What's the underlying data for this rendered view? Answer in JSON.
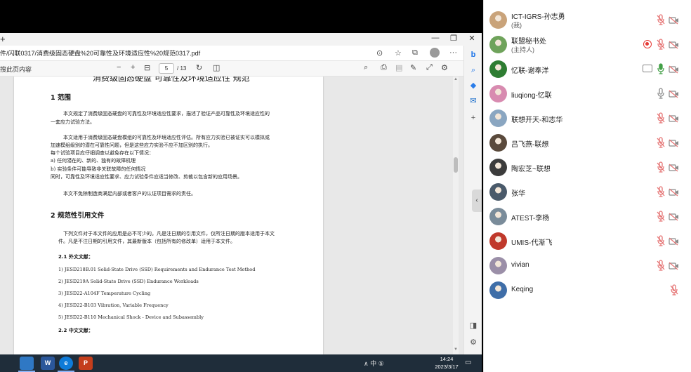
{
  "browser": {
    "new_tab_glyph": "+",
    "window_controls": {
      "minimize": "—",
      "restore": "❐",
      "close": "✕"
    },
    "url": "件/闪联0317/消费级固态硬盘%20可靠性及环境适应性%20规范0317.pdf",
    "pdf_toolbar": {
      "search_label": "搜此页内容",
      "zoom_out": "−",
      "zoom_in": "+",
      "current_page": "5",
      "total_pages": "/ 13"
    }
  },
  "document": {
    "title": "消费级固态硬盘 可靠性及环境适应性 规范",
    "section1_heading": "1  范围",
    "s1_p1_l1": "本文规定了消费级固态硬盘的可靠性及环境适应性要求，描述了验证产品可靠性及环境适应性的",
    "s1_p1_l2": "一套应力试验方法。",
    "s1_p2_l1": "本文适用于消费级固态硬盘模组的可靠性及环境适应性评估。所有应力实验已被证实可以模拟或",
    "s1_p2_l2": "加速模组级别的潜在可靠性问题，但是这些应力实验不应不加区别的执行。",
    "s1_p2_l3": "每个试验项目应仔细调查以避免存在以下情况：",
    "s1_item_a": "a)  任何潜在的、新的、独有的故障机理",
    "s1_item_b": "b)  实验条件可能导致非关联故障的任何情况",
    "s1_p2_l4": "同时，可靠性及环境适应性要求、应力试验条件应适当修改、剪裁以包含新的应用场景。",
    "s1_p3": "本文不免除制造商满足内部或者客户的认证项目需求的责任。",
    "section2_heading": "2  规范性引用文件",
    "s2_p1_l1": "下列文件对于本文件的应用是必不可少的。凡是注日期的引用文件，仅所注日期的版本适用于本文",
    "s2_p1_l2": "件。凡是不注日期的引用文件，其最新版本（包括所有的修改单）适用于本文件。",
    "s2_1_heading": "2.1  外文文献：",
    "refs": [
      "1)  JESD218B.01 Solid-State Drive (SSD) Requirements and Endurance Test Method",
      "2)  JESD219A Solid-State Drive (SSD) Endurance Workloads",
      "3)  JESD22-A104F Temperature Cycling",
      "4)  JESD22-B103 Vibration, Variable Frequency",
      "5)  JESD22-B110 Mechanical Shock  -  Device and Subassembly"
    ],
    "s2_2_heading": "2.2  中文文献："
  },
  "taskbar": {
    "apps": [
      "W",
      "e",
      "P"
    ],
    "tray_text": "∧  中  ⑤",
    "time": "14:24",
    "date": "2023/3/17"
  },
  "participants": [
    {
      "name": "ICT-IGRS-孙志勇",
      "role": "(我)",
      "mic": "muted",
      "cam": "off",
      "avatar_color": "#c9a37a"
    },
    {
      "name": "联盟秘书处",
      "role": "(主持人)",
      "mic": "muted",
      "cam": "off",
      "recording": true,
      "avatar_color": "#6fa35b"
    },
    {
      "name": "忆联-谢奉洋",
      "role": "",
      "mic": "active",
      "cam": "off",
      "sharing": true,
      "avatar_color": "#2e7d32"
    },
    {
      "name": "liuqiong-忆联",
      "role": "",
      "mic": "on",
      "cam": "off",
      "avatar_color": "#d88bb0"
    },
    {
      "name": "联想开天-和志华",
      "role": "",
      "mic": "muted",
      "cam": "off",
      "avatar_color": "#8aa6c1"
    },
    {
      "name": "吕飞燕-联想",
      "role": "",
      "mic": "muted",
      "cam": "off",
      "avatar_color": "#5a4a3c"
    },
    {
      "name": "陶宏芝~联想",
      "role": "",
      "mic": "muted",
      "cam": "off",
      "avatar_color": "#3c3c3c"
    },
    {
      "name": "张华",
      "role": "",
      "mic": "muted",
      "cam": "off",
      "avatar_color": "#4a5a6a"
    },
    {
      "name": "ATEST-李杨",
      "role": "",
      "mic": "muted",
      "cam": "off",
      "avatar_color": "#7a8c9a"
    },
    {
      "name": "UMIS-代渐飞",
      "role": "",
      "mic": "muted",
      "cam": "off",
      "avatar_color": "#c0392b"
    },
    {
      "name": "vivian",
      "role": "",
      "mic": "muted",
      "cam": "off",
      "avatar_color": "#9b8fa8"
    },
    {
      "name": "Keqing",
      "role": "",
      "mic": "muted",
      "cam": "none",
      "avatar_color": "#3f6ea8"
    }
  ],
  "colors": {
    "muted_red": "#e57373",
    "active_green": "#43a047",
    "icon_gray": "#8a8a8a",
    "taskbar": "#1f2d3a"
  },
  "icons": [
    "mic-muted-icon",
    "camera-off-icon",
    "record-icon",
    "screen-share-icon",
    "search-icon",
    "print-icon",
    "settings-icon",
    "bing-icon"
  ]
}
